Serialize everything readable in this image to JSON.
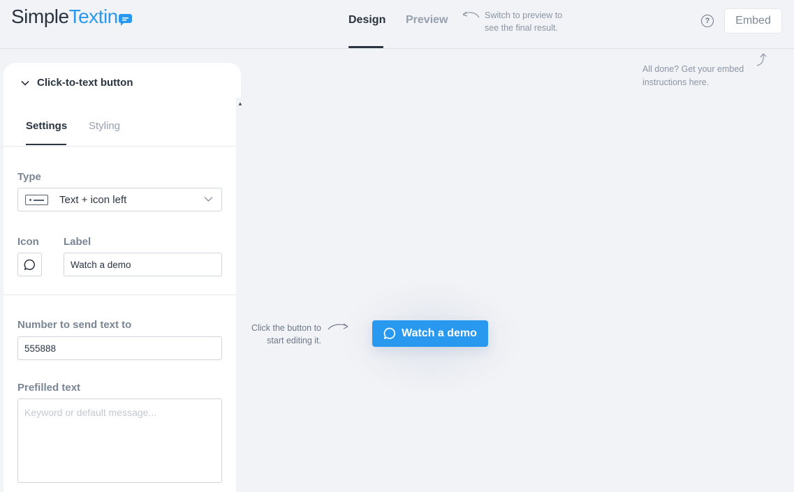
{
  "brand": {
    "part1": "Simple",
    "part2": "Textin",
    "accent": "#2899ef"
  },
  "header": {
    "tabs": [
      {
        "label": "Design",
        "active": true
      },
      {
        "label": "Preview",
        "active": false
      }
    ],
    "switch_hint_line1": "Switch to preview to",
    "switch_hint_line2": "see the final result.",
    "help_glyph": "?",
    "embed_label": "Embed",
    "embed_hint_line1": "All done? Get your embed",
    "embed_hint_line2": "instructions here."
  },
  "panel": {
    "title": "Click-to-text button",
    "subtabs": [
      {
        "label": "Settings",
        "active": true
      },
      {
        "label": "Styling",
        "active": false
      }
    ],
    "type_label": "Type",
    "type_value": "Text + icon left",
    "icon_label": "Icon",
    "label_label": "Label",
    "label_value": "Watch a demo",
    "number_label": "Number to send text to",
    "number_value": "555888",
    "prefilled_label": "Prefilled text",
    "prefilled_placeholder": "Keyword or default message..."
  },
  "canvas": {
    "hint_line1": "Click the button to",
    "hint_line2": "start editing it.",
    "button_label": "Watch a demo",
    "button_color": "#2899ef"
  }
}
